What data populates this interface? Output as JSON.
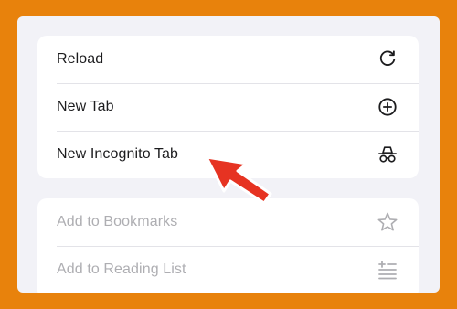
{
  "menu": {
    "group1": [
      {
        "label": "Reload",
        "icon": "reload-icon",
        "enabled": true
      },
      {
        "label": "New Tab",
        "icon": "plus-circle-icon",
        "enabled": true
      },
      {
        "label": "New Incognito Tab",
        "icon": "incognito-icon",
        "enabled": true
      }
    ],
    "group2": [
      {
        "label": "Add to Bookmarks",
        "icon": "star-icon",
        "enabled": false
      },
      {
        "label": "Add to Reading List",
        "icon": "reading-list-icon",
        "enabled": false
      }
    ]
  },
  "colors": {
    "background": "#E8820C",
    "sheet": "#F2F2F7",
    "text": "#1C1C1E",
    "disabled_text": "#AEAEB2",
    "annotation_arrow": "#E63322"
  }
}
